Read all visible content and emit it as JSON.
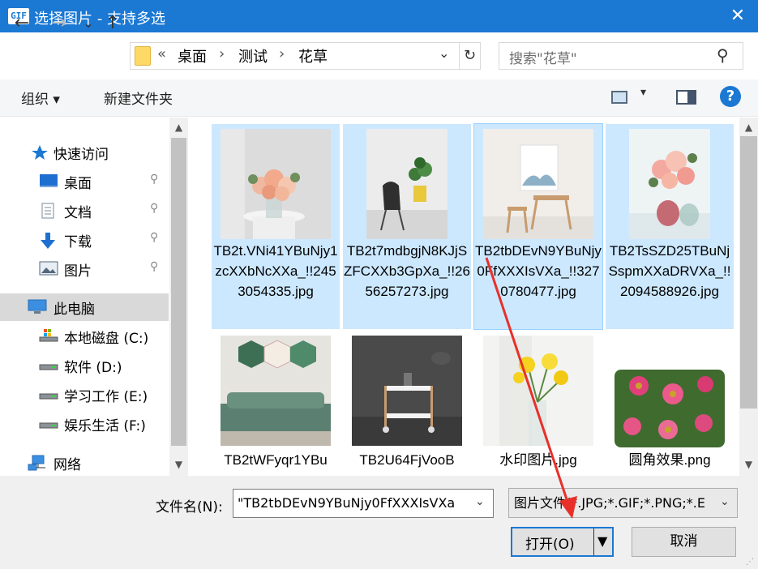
{
  "window": {
    "app_icon": "GIF",
    "title": "选择图片 - 支持多选",
    "close_glyph": "✕"
  },
  "nav": {
    "back_glyph": "←",
    "forward_glyph": "→",
    "recent_glyph": "⌄",
    "up_glyph": "↑",
    "overflow": "«",
    "breadcrumbs": [
      "桌面",
      "测试",
      "花草"
    ],
    "separator": "›",
    "refresh_glyph": "↻",
    "search_placeholder": "搜索\"花草\"",
    "search_icon": "search-icon"
  },
  "toolbar": {
    "organize_label": "组织 ▾",
    "new_folder_label": "新建文件夹",
    "view_dropdown": "▾",
    "help_label": "?"
  },
  "sidebar": {
    "items": [
      {
        "label": "快速访问",
        "icon": "star-icon",
        "pinned": false
      },
      {
        "label": "桌面",
        "icon": "desktop-icon",
        "pinned": true
      },
      {
        "label": "文档",
        "icon": "document-icon",
        "pinned": true
      },
      {
        "label": "下载",
        "icon": "download-icon",
        "pinned": true
      },
      {
        "label": "图片",
        "icon": "pictures-icon",
        "pinned": true
      },
      {
        "label": "此电脑",
        "icon": "computer-icon",
        "pinned": false,
        "selected": true
      },
      {
        "label": "本地磁盘 (C:)",
        "icon": "drive-c-icon",
        "pinned": false
      },
      {
        "label": "软件 (D:)",
        "icon": "drive-icon",
        "pinned": false
      },
      {
        "label": "学习工作 (E:)",
        "icon": "drive-icon",
        "pinned": false
      },
      {
        "label": "娱乐生活 (F:)",
        "icon": "drive-icon",
        "pinned": false
      },
      {
        "label": "网络",
        "icon": "network-icon",
        "pinned": false
      }
    ],
    "pin_glyph": "📌"
  },
  "files": [
    {
      "name": "TB2t.VNi41YBuNjy1zcXXbNcXXa_!!2453054335.jpg",
      "selected": true,
      "thumb": "roses-vase-table"
    },
    {
      "name": "TB2t7mdbgjN8KJjSZFCXXb3GpXa_!!2656257273.jpg",
      "selected": true,
      "thumb": "chair-plant"
    },
    {
      "name": "TB2tbDEvN9YBuNjy0FfXXXIsVXa_!!3270780477.jpg",
      "selected": true,
      "focused": true,
      "thumb": "stools-room"
    },
    {
      "name": "TB2TsSZD25TBuNjSspmXXaDRVXa_!!2094588926.jpg",
      "selected": true,
      "thumb": "peony-vase"
    },
    {
      "name": "TB2tWFyqr1YBu",
      "selected": false,
      "thumb": "sofa-hexagons"
    },
    {
      "name": "TB2U64FjVooB",
      "selected": false,
      "thumb": "side-table"
    },
    {
      "name": "水印图片.jpg",
      "selected": false,
      "thumb": "yellow-lilies"
    },
    {
      "name": "圆角效果.png",
      "selected": false,
      "thumb": "pink-zinnias"
    }
  ],
  "footer": {
    "filename_label": "文件名(N):",
    "filename_value": "\"TB2tbDEvN9YBuNjy0FfXXXIsVXa",
    "filetype_value": "图片文件(*.JPG;*.GIF;*.PNG;*.E",
    "open_label": "打开(O)",
    "cancel_label": "取消"
  },
  "colors": {
    "titlebar": "#1b78d3",
    "selection": "#cce8ff",
    "annotation_arrow": "#e8302a"
  }
}
